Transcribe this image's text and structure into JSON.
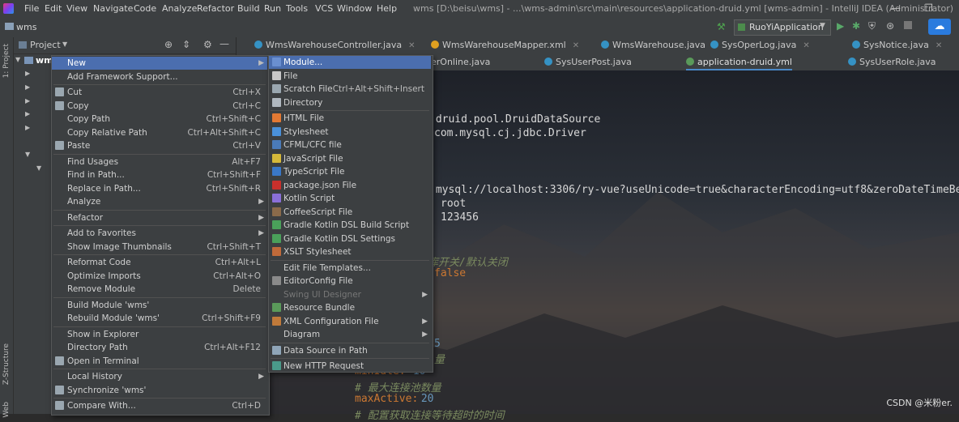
{
  "titlebar": {
    "menus": [
      "File",
      "Edit",
      "View",
      "Navigate",
      "Code",
      "Analyze",
      "Refactor",
      "Build",
      "Run",
      "Tools",
      "VCS",
      "Window",
      "Help"
    ],
    "title": "wms [D:\\beisu\\wms] - ...\\wms-admin\\src\\main\\resources\\application-druid.yml [wms-admin] - IntelliJ IDEA (Administrator)"
  },
  "navbar": {
    "project": "wms",
    "run_config": "RuoYiApplication"
  },
  "project_panel": {
    "header": "Project",
    "root": "wm"
  },
  "stripe": {
    "project_label": "1: Project",
    "structure_label": "Z-Structure",
    "web_label": "Web"
  },
  "tabs_row1": [
    "WmsWarehouseController.java",
    "WmsWarehouseMapper.xml",
    "WmsWarehouse.java",
    "SysOperLog.java",
    "SysNotice.java"
  ],
  "tabs_row2": [
    "erOnline.java",
    "SysUserPost.java",
    "application-druid.yml",
    "SysUserRole.java"
  ],
  "code": {
    "l1": ".druid.pool.DruidDataSource",
    "l2": "com.mysql.cj.jdbc.Driver",
    "l3": ":mysql://localhost:3306/ry-vue?useUnicode=true&characterEncoding=utf8&zeroDateTimeBeha",
    "l4": "root",
    "l5": "123456",
    "l6": "库开关/默认关闭",
    "l7": "false",
    "l8": "5",
    "l9": "量",
    "l10_key": "minIdle:",
    "l10_val": " 10",
    "l11": "# 最大连接池数量",
    "l12_key": "maxActive:",
    "l12_val": " 20",
    "l13": "# 配置获取连接等待超时的时间"
  },
  "context_menu": [
    {
      "label": "New",
      "shortcut": "",
      "submenu": true,
      "selected": true
    },
    {
      "label": "Add Framework Support...",
      "shortcut": ""
    },
    {
      "sep": true
    },
    {
      "label": "Cut",
      "shortcut": "Ctrl+X",
      "icon": "scissors-icon"
    },
    {
      "label": "Copy",
      "shortcut": "Ctrl+C",
      "icon": "copy-icon"
    },
    {
      "label": "Copy Path",
      "shortcut": "Ctrl+Shift+C"
    },
    {
      "label": "Copy Relative Path",
      "shortcut": "Ctrl+Alt+Shift+C"
    },
    {
      "label": "Paste",
      "shortcut": "Ctrl+V",
      "icon": "paste-icon"
    },
    {
      "sep": true
    },
    {
      "label": "Find Usages",
      "shortcut": "Alt+F7"
    },
    {
      "label": "Find in Path...",
      "shortcut": "Ctrl+Shift+F"
    },
    {
      "label": "Replace in Path...",
      "shortcut": "Ctrl+Shift+R"
    },
    {
      "label": "Analyze",
      "shortcut": "",
      "submenu": true
    },
    {
      "sep": true
    },
    {
      "label": "Refactor",
      "shortcut": "",
      "submenu": true
    },
    {
      "sep": true
    },
    {
      "label": "Add to Favorites",
      "shortcut": "",
      "submenu": true
    },
    {
      "label": "Show Image Thumbnails",
      "shortcut": "Ctrl+Shift+T"
    },
    {
      "sep": true
    },
    {
      "label": "Reformat Code",
      "shortcut": "Ctrl+Alt+L"
    },
    {
      "label": "Optimize Imports",
      "shortcut": "Ctrl+Alt+O"
    },
    {
      "label": "Remove Module",
      "shortcut": "Delete"
    },
    {
      "sep": true
    },
    {
      "label": "Build Module 'wms'",
      "shortcut": ""
    },
    {
      "label": "Rebuild Module 'wms'",
      "shortcut": "Ctrl+Shift+F9"
    },
    {
      "sep": true
    },
    {
      "label": "Show in Explorer",
      "shortcut": ""
    },
    {
      "label": "Directory Path",
      "shortcut": "Ctrl+Alt+F12"
    },
    {
      "label": "Open in Terminal",
      "shortcut": "",
      "icon": "terminal-icon"
    },
    {
      "sep": true
    },
    {
      "label": "Local History",
      "shortcut": "",
      "submenu": true
    },
    {
      "label": "Synchronize 'wms'",
      "shortcut": "",
      "icon": "sync-icon"
    },
    {
      "sep": true
    },
    {
      "label": "Compare With...",
      "shortcut": "Ctrl+D",
      "icon": "compare-icon"
    }
  ],
  "submenu": [
    {
      "label": "Module...",
      "shortcut": "",
      "selected": true,
      "icon": "module-icon",
      "color": "#6a8fd0"
    },
    {
      "label": "File",
      "shortcut": "",
      "icon": "file-icon",
      "color": "#c8c8c8"
    },
    {
      "label": "Scratch File",
      "shortcut": "Ctrl+Alt+Shift+Insert",
      "icon": "scratch-icon",
      "color": "#9aa7b0"
    },
    {
      "label": "Directory",
      "shortcut": "",
      "icon": "folder-icon",
      "color": "#b0b8c0"
    },
    {
      "sep": true
    },
    {
      "label": "HTML File",
      "shortcut": "",
      "icon": "html-icon",
      "color": "#e37933"
    },
    {
      "label": "Stylesheet",
      "shortcut": "",
      "icon": "css-icon",
      "color": "#4a90d9"
    },
    {
      "label": "CFML/CFC file",
      "shortcut": "",
      "icon": "cfml-icon",
      "color": "#4a7ab8"
    },
    {
      "label": "JavaScript File",
      "shortcut": "",
      "icon": "js-icon",
      "color": "#d6b93a"
    },
    {
      "label": "TypeScript File",
      "shortcut": "",
      "icon": "ts-icon",
      "color": "#3a78c8"
    },
    {
      "label": "package.json File",
      "shortcut": "",
      "icon": "npm-icon",
      "color": "#c9302c"
    },
    {
      "label": "Kotlin Script",
      "shortcut": "",
      "icon": "kotlin-icon",
      "color": "#8a6fd8"
    },
    {
      "label": "CoffeeScript File",
      "shortcut": "",
      "icon": "coffee-icon",
      "color": "#8a6a4a"
    },
    {
      "label": "Gradle Kotlin DSL Build Script",
      "shortcut": "",
      "icon": "gradle-icon",
      "color": "#4aa05a"
    },
    {
      "label": "Gradle Kotlin DSL Settings",
      "shortcut": "",
      "icon": "gradle-settings-icon",
      "color": "#4aa05a"
    },
    {
      "label": "XSLT Stylesheet",
      "shortcut": "",
      "icon": "xslt-icon",
      "color": "#c06a3a"
    },
    {
      "sep": true
    },
    {
      "label": "Edit File Templates...",
      "shortcut": ""
    },
    {
      "label": "EditorConfig File",
      "shortcut": "",
      "icon": "editorconfig-icon",
      "color": "#8a8a8a"
    },
    {
      "label": "Swing UI Designer",
      "shortcut": "",
      "submenu": true,
      "disabled": true
    },
    {
      "label": "Resource Bundle",
      "shortcut": "",
      "icon": "bundle-icon",
      "color": "#5a9a5a"
    },
    {
      "label": "XML Configuration File",
      "shortcut": "",
      "submenu": true,
      "icon": "xml-icon",
      "color": "#c07a3a"
    },
    {
      "label": "Diagram",
      "shortcut": "",
      "submenu": true
    },
    {
      "sep": true
    },
    {
      "label": "Data Source in Path",
      "shortcut": "",
      "icon": "database-icon",
      "color": "#8fa5b8"
    },
    {
      "sep": true
    },
    {
      "label": "New HTTP Request",
      "shortcut": "",
      "icon": "http-icon",
      "color": "#4a9a8a"
    }
  ],
  "watermark": "CSDN @米粉er."
}
